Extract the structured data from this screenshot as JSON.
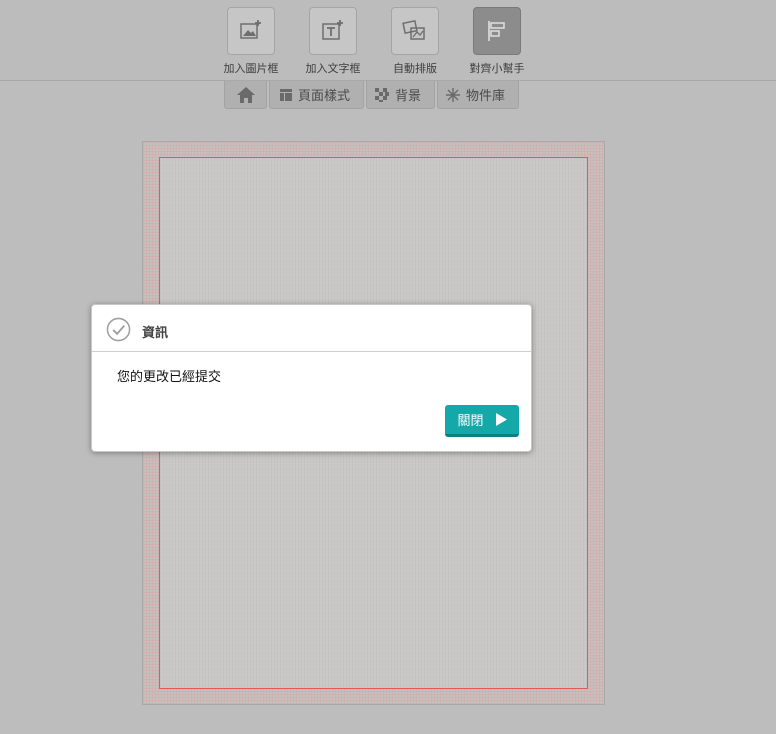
{
  "toolbar": {
    "tools": [
      {
        "label": "加入圖片框",
        "icon": "add-image-icon"
      },
      {
        "label": "加入文字框",
        "icon": "add-text-icon"
      },
      {
        "label": "自動排版",
        "icon": "auto-layout-icon"
      },
      {
        "label": "對齊小幫手",
        "icon": "align-helper-icon",
        "active": true
      }
    ]
  },
  "tabs": [
    {
      "label": "",
      "icon": "home-icon"
    },
    {
      "label": "頁面樣式",
      "icon": "page-style-icon"
    },
    {
      "label": "背景",
      "icon": "background-icon"
    },
    {
      "label": "物件庫",
      "icon": "object-library-icon"
    }
  ],
  "dialog": {
    "title": "資訊",
    "message": "您的更改已經提交",
    "close_label": "關閉"
  },
  "colors": {
    "accent": "#14a8a8",
    "margin_line": "#e05a5a",
    "background": "#bdbdbd"
  }
}
